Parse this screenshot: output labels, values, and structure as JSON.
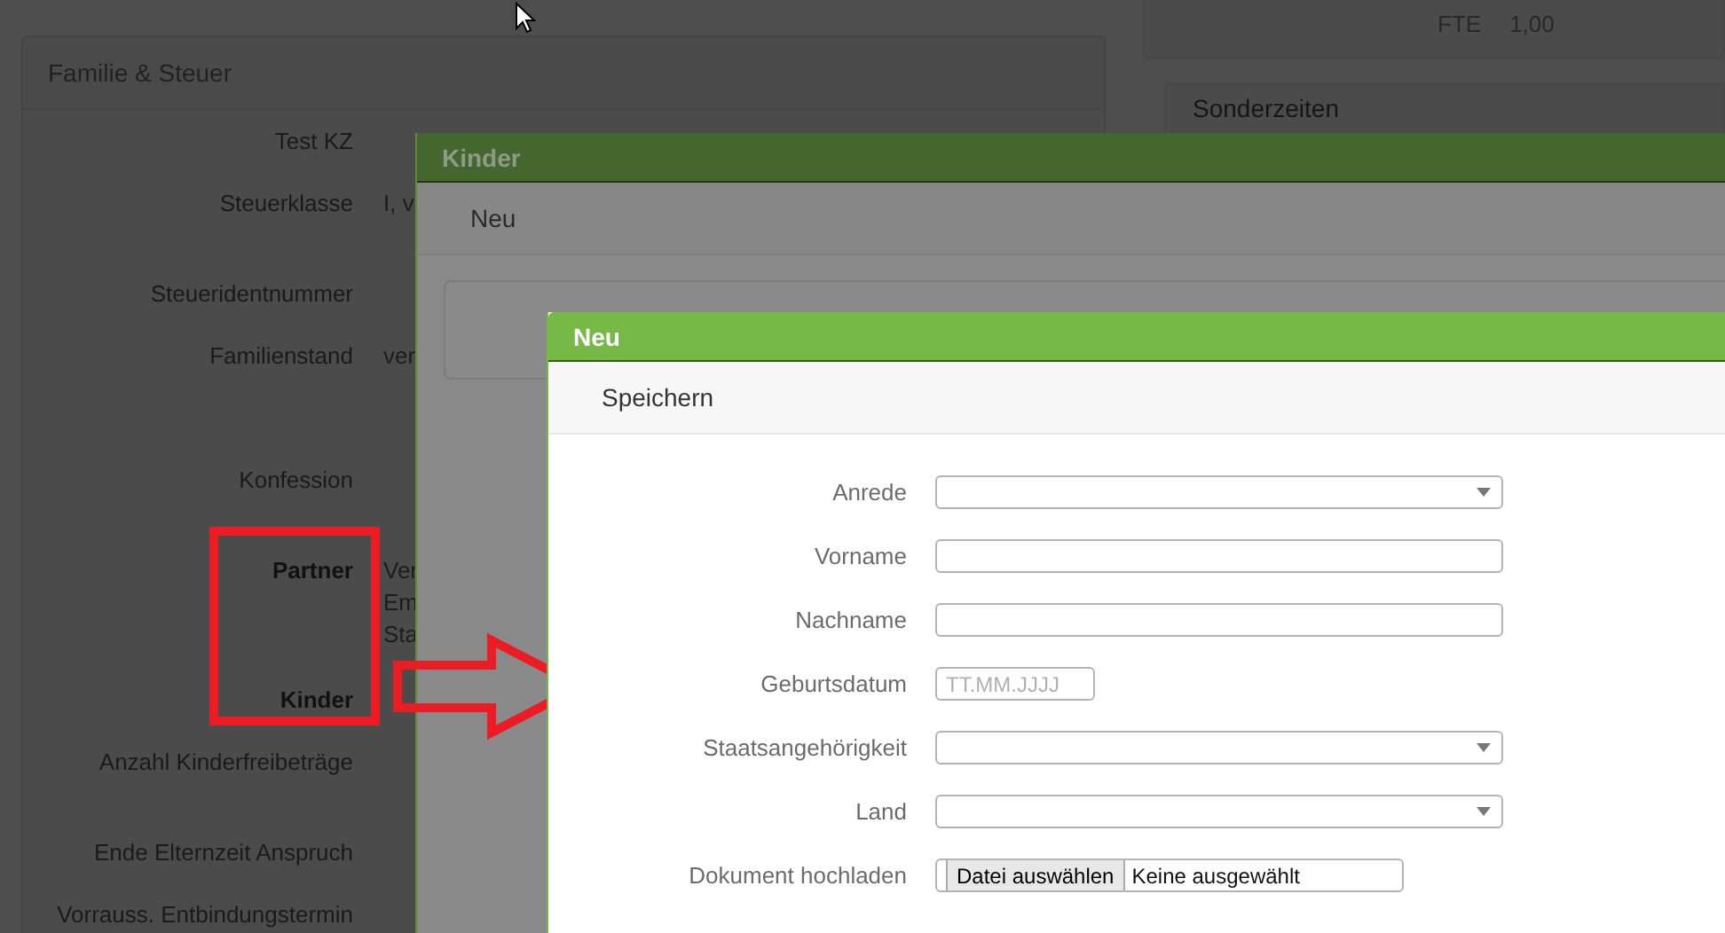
{
  "background": {
    "panel": {
      "title": "Familie & Steuer",
      "rows": [
        {
          "label": "Test KZ",
          "bold": false
        },
        {
          "label": "Steuerklasse",
          "bold": false,
          "values": [
            "I, v"
          ]
        },
        {
          "label": "Steueridentnummer",
          "bold": false
        },
        {
          "label": "Familienstand",
          "bold": false,
          "values": [
            "ver"
          ]
        },
        {
          "label": "Konfession",
          "bold": false
        },
        {
          "label": "Partner",
          "bold": true,
          "values": [
            "Ver",
            "Em",
            "Sta"
          ]
        },
        {
          "label": "Kinder",
          "bold": true
        },
        {
          "label": "Anzahl Kinderfreibeträge",
          "bold": false
        },
        {
          "label": "Ende Elternzeit Anspruch",
          "bold": false
        },
        {
          "label": "Vorrauss. Entbindungstermin",
          "bold": false
        }
      ]
    },
    "side_card": {
      "label": "FTE",
      "value": "1,00"
    },
    "side_panel": {
      "title": "Sonderzeiten"
    }
  },
  "kinder_dialog": {
    "title": "Kinder",
    "toolbar": [
      "Neu"
    ]
  },
  "neu_dialog": {
    "title": "Neu",
    "toolbar": [
      "Speichern"
    ],
    "fields": [
      {
        "label": "Anrede",
        "kind": "select"
      },
      {
        "label": "Vorname",
        "kind": "text"
      },
      {
        "label": "Nachname",
        "kind": "text"
      },
      {
        "label": "Geburtsdatum",
        "kind": "date",
        "placeholder": "TT.MM.JJJJ"
      },
      {
        "label": "Staatsangehörigkeit",
        "kind": "select"
      },
      {
        "label": "Land",
        "kind": "select"
      },
      {
        "label": "Dokument hochladen",
        "kind": "file",
        "button": "Datei auswählen",
        "status": "Keine ausgewählt"
      }
    ]
  }
}
